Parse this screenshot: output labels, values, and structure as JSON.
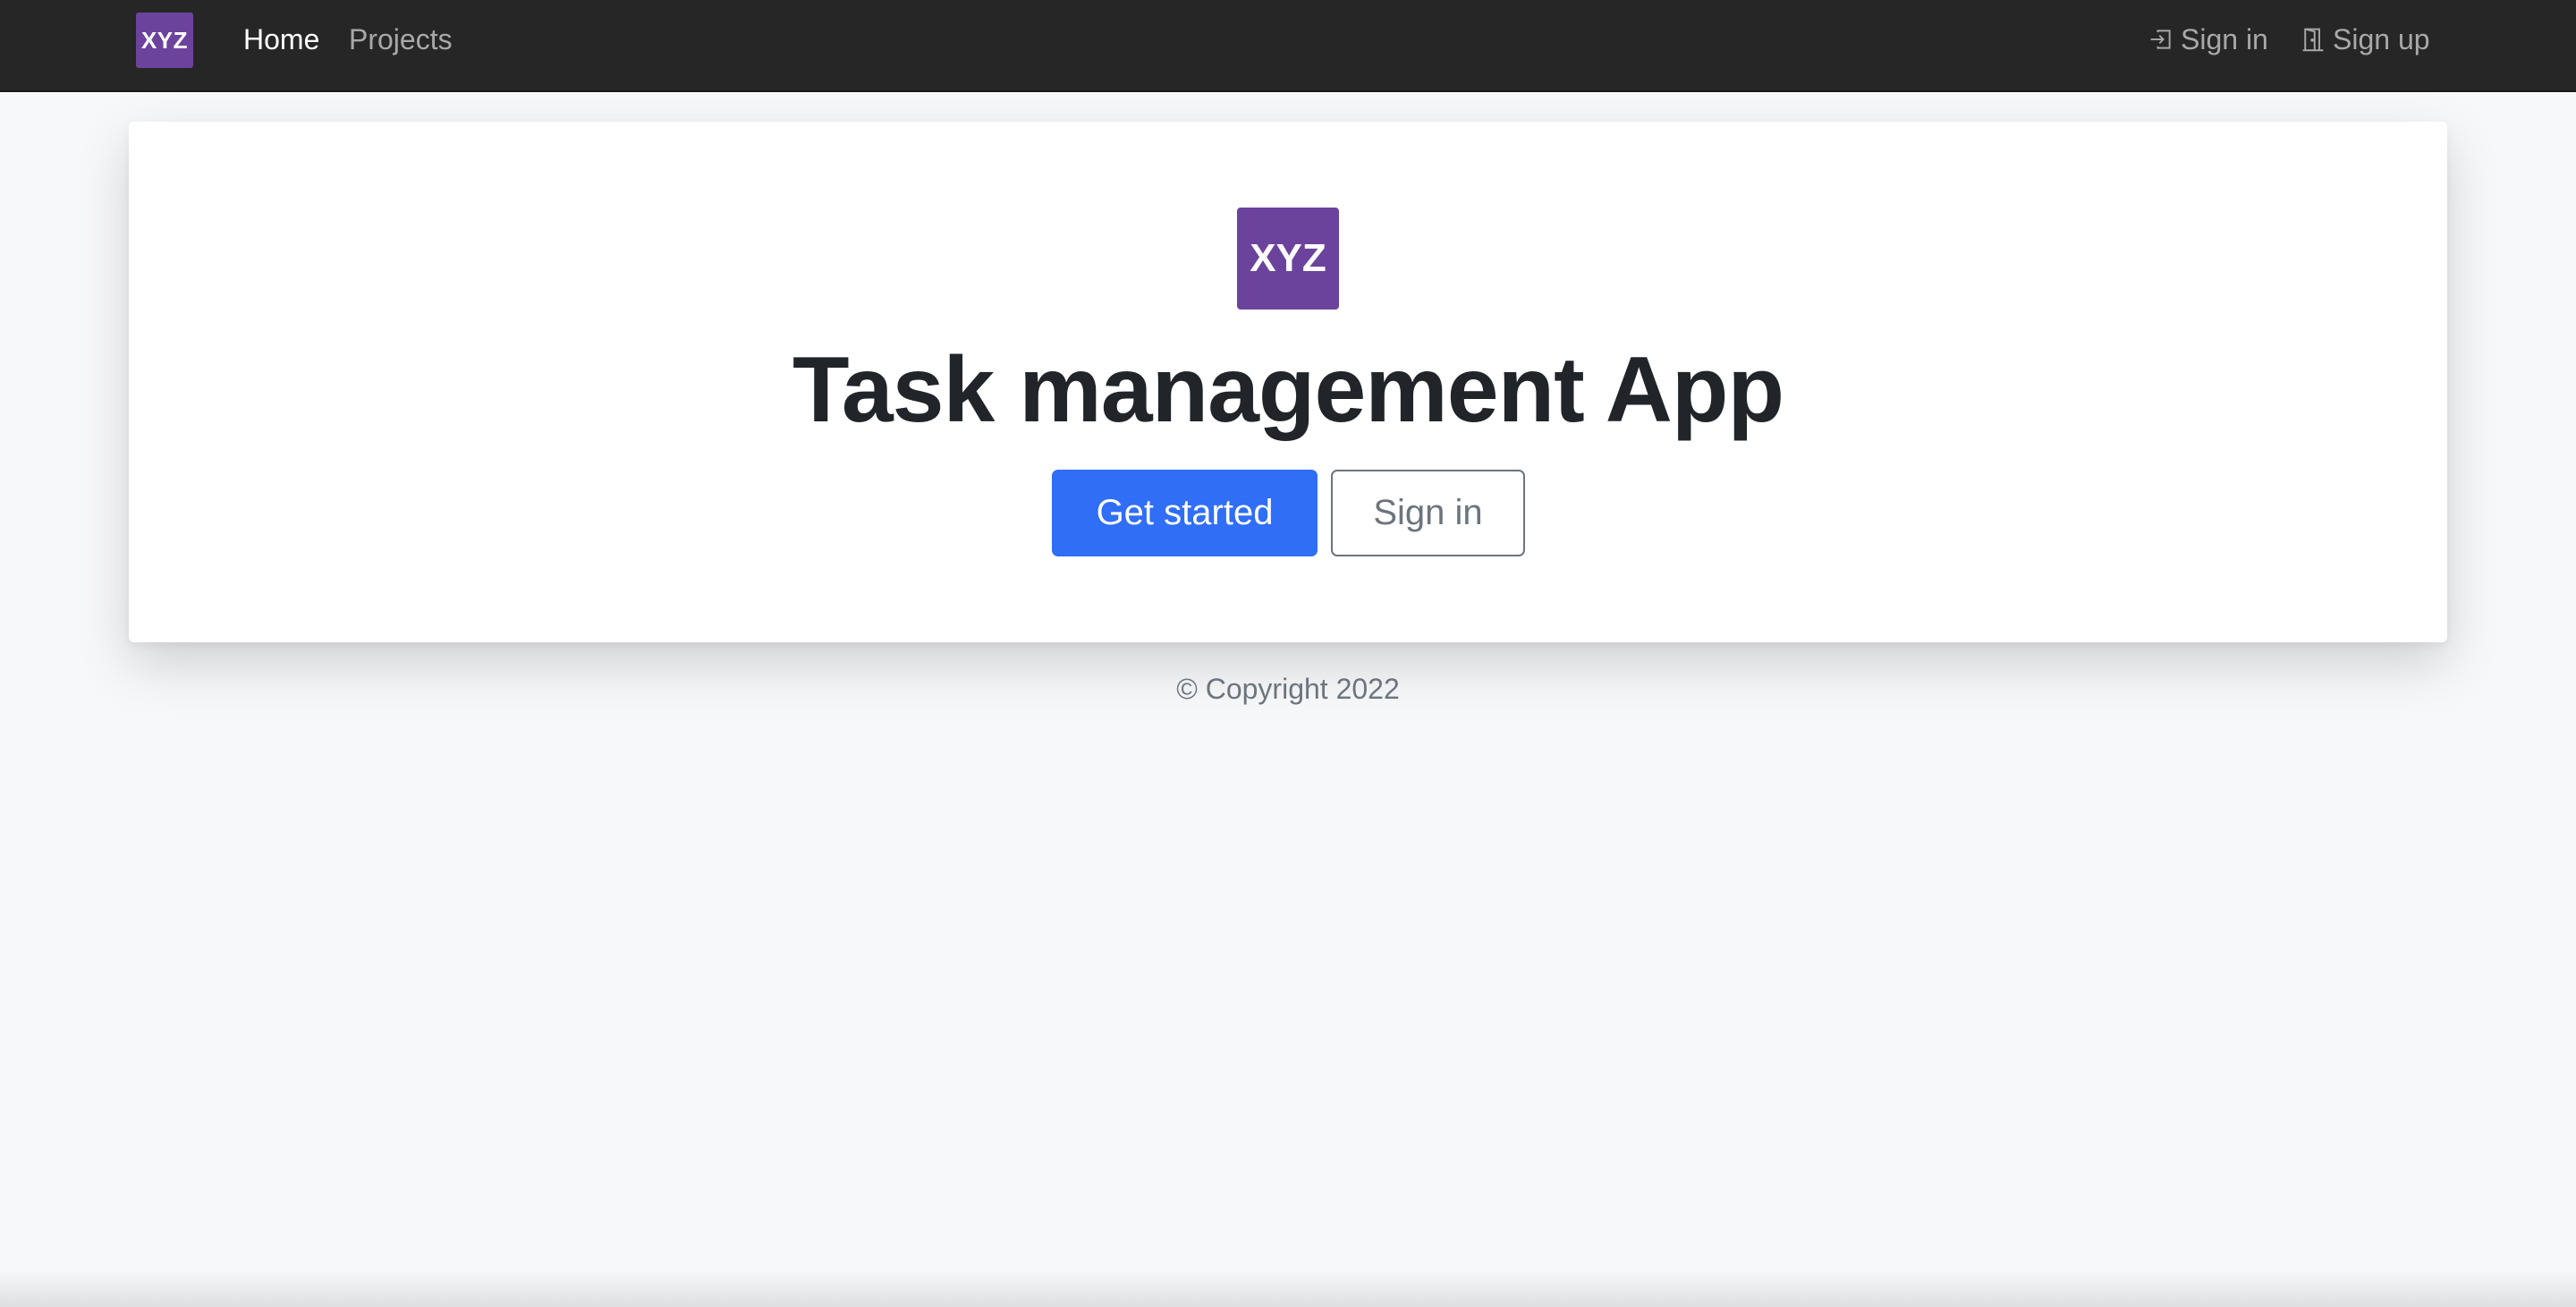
{
  "navbar": {
    "logo_text": "XYZ",
    "links": {
      "home": "Home",
      "projects": "Projects"
    },
    "signin_label": "Sign in",
    "signup_label": "Sign up",
    "signin_icon": "box-arrow-in-right-icon",
    "signup_icon": "door-icon"
  },
  "hero": {
    "logo_text": "XYZ",
    "title": "Task management App",
    "primary_button": "Get started",
    "secondary_button": "Sign in"
  },
  "footer": {
    "copyright": "© Copyright 2022"
  },
  "colors": {
    "navbar_bg": "#262626",
    "brand": "#6c439c",
    "primary": "#2f6ef5",
    "page_bg": "#f7f8fa"
  }
}
